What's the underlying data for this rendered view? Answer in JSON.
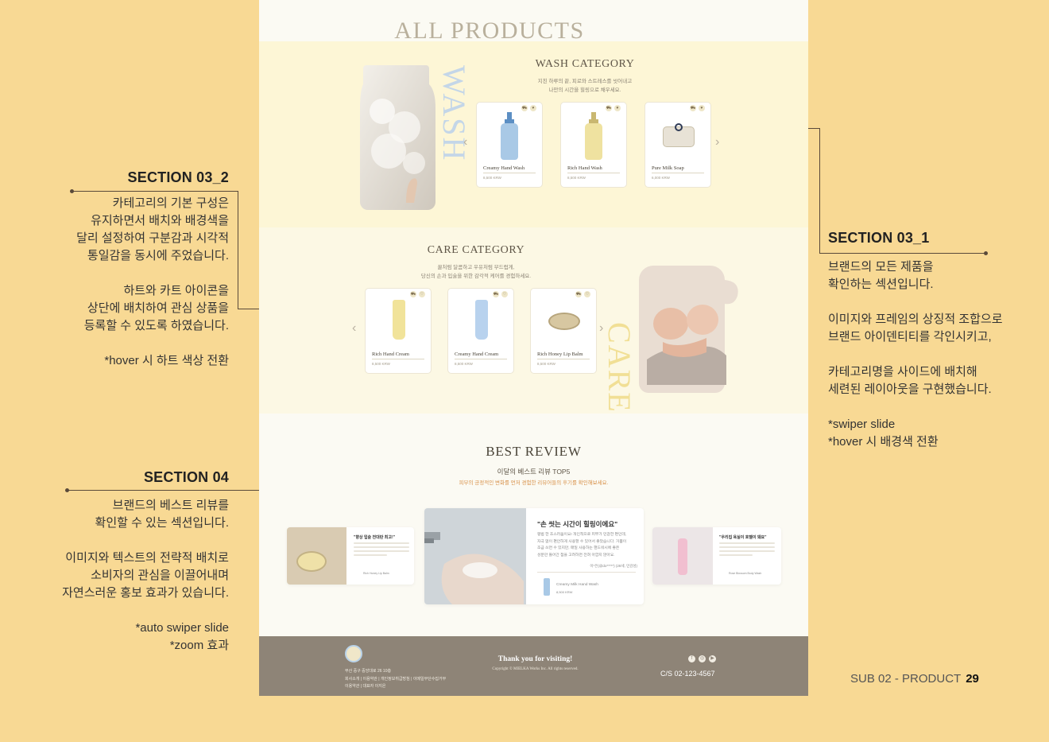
{
  "annotations": {
    "s03_2": {
      "title": "SECTION 03_2",
      "p1": [
        "카테고리의 기본 구성은",
        "유지하면서 배치와 배경색을",
        "달리 설정하여 구분감과 시각적",
        "통일감을 동시에 주었습니다."
      ],
      "p2": [
        "하트와 카트 아이콘을",
        "상단에 배치하여 관심 상품을",
        "등록할 수 있도록 하였습니다."
      ],
      "p3": [
        "*hover 시 하트 색상 전환"
      ]
    },
    "s04": {
      "title": "SECTION 04",
      "p1": [
        "브랜드의 베스트 리뷰를",
        "확인할 수 있는 섹션입니다."
      ],
      "p2": [
        "이미지와 텍스트의 전략적 배치로",
        "소비자의 관심을 이끌어내며",
        "자연스러운 홍보 효과가 있습니다."
      ],
      "p3": [
        "*auto swiper slide",
        "*zoom 효과"
      ]
    },
    "s03_1": {
      "title": "SECTION 03_1",
      "p1": [
        "브랜드의 모든 제품을",
        "확인하는 섹션입니다."
      ],
      "p2": [
        "이미지와 프레임의 상징적 조합으로",
        "브랜드 아이덴티티를 각인시키고,"
      ],
      "p3": [
        "카테고리명을 사이드에 배치해",
        "세련된 레이아웃을 구현했습니다."
      ],
      "p4": [
        "*swiper slide",
        "*hover 시 배경색 전환"
      ]
    }
  },
  "page": {
    "all_title": "ALL PRODUCTS",
    "wash": {
      "title": "WASH CATEGORY",
      "side": "WASH",
      "desc": [
        "지친 하루의 끝, 피로와 스트레스를 씻어내고",
        "나만의 시간을 힐링으로 채우세요."
      ],
      "products": [
        {
          "name": "Creamy Hand Wash",
          "price": "8,500 KRW",
          "color": "#a9c9e6"
        },
        {
          "name": "Rich Hand Wash",
          "price": "8,500 KRW",
          "color": "#efe2a0"
        },
        {
          "name": "Pure Milk Soap",
          "price": "6,000 KRW",
          "color": "#e8e2d6"
        }
      ]
    },
    "care": {
      "title": "CARE CATEGORY",
      "side": "CARE",
      "desc": [
        "꿀처럼 달콤하고 우유처럼 부드럽게,",
        "당신의 손과 입술을 위한 감각적 케어를 경험하세요."
      ],
      "products": [
        {
          "name": "Rich Hand Cream",
          "price": "8,500 KRW",
          "color": "#f1e39a"
        },
        {
          "name": "Creamy Hand Cream",
          "price": "8,500 KRW",
          "color": "#b8d2ee"
        },
        {
          "name": "Rich Honey Lip Balm",
          "price": "8,500 KRW",
          "color": "#d7c7a1"
        }
      ]
    },
    "review": {
      "title": "BEST REVIEW",
      "subtitle": "이달의 베스트 리뷰 TOP5",
      "subtitle2": "피부의 긍정적인 변화를 먼저 경험한 리뷰어들의 후기를 확인해보세요.",
      "left": {
        "title": "\"향상 입술 전대란 최고!\"",
        "product": "Rich Honey Lip Balm"
      },
      "main": {
        "title": "\"손 씻는 시간이 힐링이에요\"",
        "body": [
          "평범 한 조스러움이요! 개인적으로 피부가 민감한 편인데,",
          "자극 없이 편안하게 사용할 수 있어서 좋았습니다. 거품이",
          "조금 쓰면 수 있지만, 매일 사용하는 핸드워시에 좋은",
          "성분만 들어간 점을 고려하면 전혀 아깝지 않아요."
        ],
        "author": "이*은(@do*****) (28세, 민감성)",
        "product": "Creamy Milk Hand Wash",
        "price": "8,500 KRW"
      },
      "right": {
        "title": "\"우리집 욕실이 호텔이 돼요\"",
        "product": "Rose Blossom Body Wash"
      }
    },
    "footer": {
      "addr": "부산 중구 중앙대로 26 10층",
      "links": "회사소개  |  이용약관  |  개인정보취급방침  |  이메일무단수집거부",
      "links2": "이용약관 | 대표자 이지은",
      "thanks": "Thank you for visiting!",
      "copy": "Copyright © MIELKA Works Inc. All rights reserved.",
      "cs": "C/S 02-123-4567",
      "social": [
        "f",
        "◎",
        "▶"
      ]
    }
  },
  "page_number": {
    "label": "SUB 02 - PRODUCT",
    "num": "29"
  }
}
